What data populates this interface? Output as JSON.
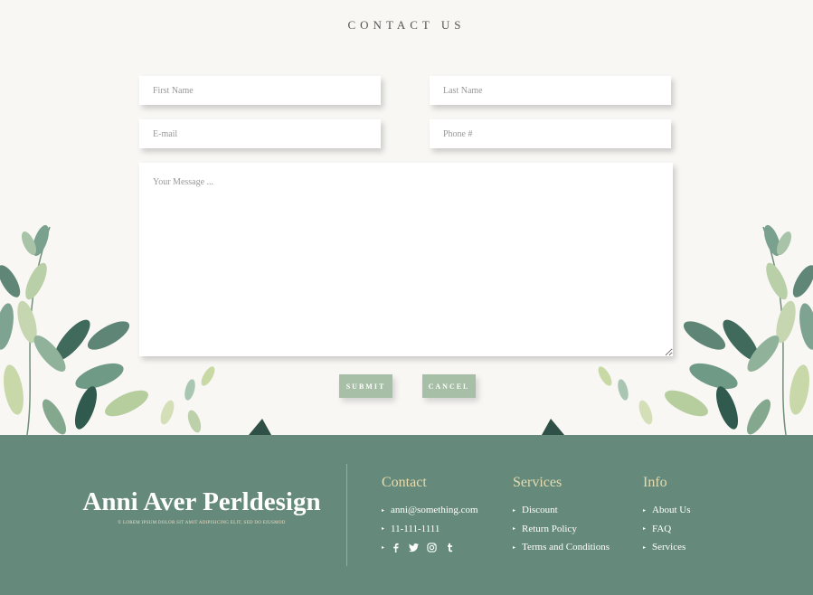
{
  "contact": {
    "title": "CONTACT US",
    "first_name_placeholder": "First Name",
    "last_name_placeholder": "Last Name",
    "email_placeholder": "E-mail",
    "phone_placeholder": "Phone #",
    "message_placeholder": "Your Message ...",
    "submit_label": "SUBMIT",
    "cancel_label": "CANCEL"
  },
  "footer": {
    "brand_name": "Anni Aver Perldesign",
    "brand_tagline": "© LOREM IPSUM DOLOR SIT AMIT ADIPISICING ELIT, SED DO EIUSMOD",
    "contact_title": "Contact",
    "email": "anni@something.com",
    "phone": "11-111-1111",
    "social_icons": [
      "facebook-icon",
      "twitter-icon",
      "instagram-icon",
      "tumblr-icon"
    ],
    "services_title": "Services",
    "services": [
      "Discount",
      "Return Policy",
      "Terms and Conditions"
    ],
    "info_title": "Info",
    "info": [
      "About Us",
      "FAQ",
      "Services"
    ]
  },
  "colors": {
    "background": "#f8f7f4",
    "footer_bg": "#658a7c",
    "button_bg": "#a6bfa6",
    "footer_heading": "#e6dcae",
    "divider": "#c9a35e"
  }
}
